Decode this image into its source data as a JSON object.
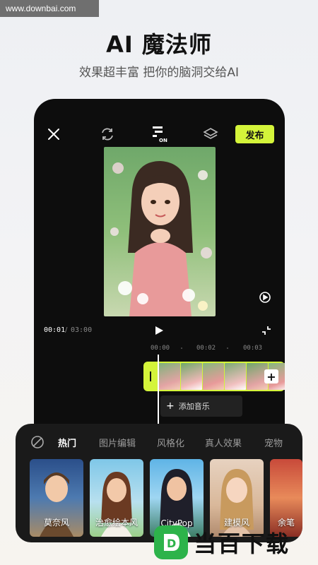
{
  "watermark": {
    "text": "www.downbai.com"
  },
  "hero": {
    "title": "AI 魔法师",
    "subtitle": "效果超丰富 把你的脑洞交给AI"
  },
  "editor": {
    "publish_label": "发布",
    "on_badge": "ON",
    "time_current": "00:01",
    "time_separator": "/",
    "time_total": "03:00",
    "ruler": [
      "00:00",
      "00:02",
      "00:03"
    ],
    "add_music_label": "添加音乐"
  },
  "effects": {
    "tabs": [
      "热门",
      "图片编辑",
      "风格化",
      "真人效果",
      "宠物"
    ],
    "active_tab": "热门",
    "cards": [
      {
        "label": "莫奈风"
      },
      {
        "label": "治愈绘本风"
      },
      {
        "label": "CityPop"
      },
      {
        "label": "建模风"
      },
      {
        "label": "余笔"
      }
    ]
  },
  "brand": {
    "name": "当百下载",
    "logo_letter": "D",
    "accent": "#2db34a"
  },
  "colors": {
    "accent": "#d4f43a",
    "phone_bg": "#0d0d0d",
    "panel_bg": "#1a1a1a"
  }
}
